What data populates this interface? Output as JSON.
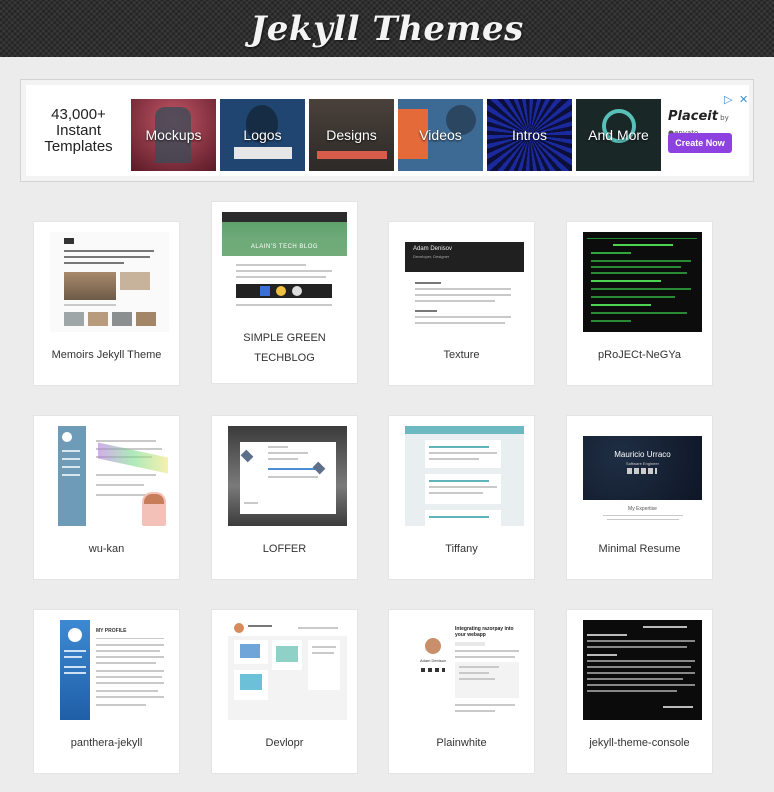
{
  "header": {
    "title": "Jekyll Themes"
  },
  "ad": {
    "lead": [
      "43,000+",
      "Instant",
      "Templates"
    ],
    "tiles": [
      {
        "label": "Mockups",
        "color": "#8c2e3c"
      },
      {
        "label": "Logos",
        "color": "#1d3e63"
      },
      {
        "label": "Designs",
        "color": "#3f3a36"
      },
      {
        "label": "Videos",
        "color": "#3b5f86"
      },
      {
        "label": "Intros",
        "color": "#1a1f67"
      },
      {
        "label": "And More",
        "color": "#1d2d2e"
      }
    ],
    "brand": "Placeit",
    "brand_by": "by envato",
    "cta": "Create Now",
    "choices_icon": "adchoices-icon",
    "close_icon": "close-icon"
  },
  "themes": [
    {
      "name": "Memoirs Jekyll Theme"
    },
    {
      "name": "SIMPLE GREEN TECHBLOG",
      "thumb_title": "ALAIN'S TECH BLOG"
    },
    {
      "name": "Texture",
      "thumb_title": "Adam Denisov",
      "thumb_sub": "Developer, Designer"
    },
    {
      "name": "pRoJECt-NeGYa"
    },
    {
      "name": "wu-kan"
    },
    {
      "name": "LOFFER"
    },
    {
      "name": "Tiffany"
    },
    {
      "name": "Minimal Resume",
      "thumb_title": "Mauricio Urraco",
      "thumb_sub": "Software Engineer",
      "thumb_section": "My Expertise"
    },
    {
      "name": "panthera-jekyll",
      "thumb_title": "MY PROFILE"
    },
    {
      "name": "Devlopr"
    },
    {
      "name": "Plainwhite",
      "thumb_title": "Integrating razorpay into your webapp",
      "thumb_author": "Adam Denisov"
    },
    {
      "name": "jekyll-theme-console"
    }
  ]
}
